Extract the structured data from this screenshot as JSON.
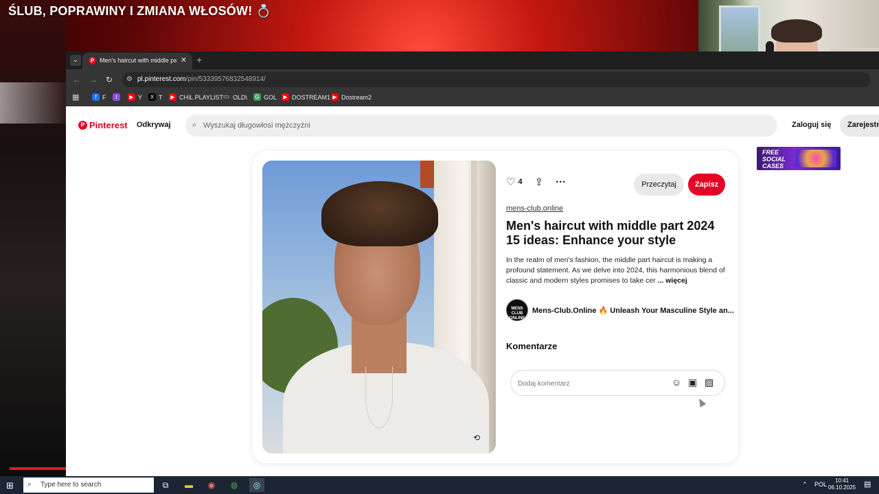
{
  "stream": {
    "title": "ŚLUB, POPRAWINY I ZMIANA WŁOSÓW! 💍"
  },
  "browser": {
    "tab_title": "Men's haircut with middle part",
    "tab_close": "✕",
    "url_host": "pl.pinterest.com",
    "url_path": "/pin/53339576832548914/",
    "bookmarks": [
      {
        "label": "F",
        "icon": "facebook-icon",
        "color": "#1877f2"
      },
      {
        "label": "",
        "icon": "twitch-icon",
        "color": "#9146ff"
      },
      {
        "label": "Y",
        "icon": "youtube-icon",
        "color": "#ff0000"
      },
      {
        "label": "T",
        "icon": "x-icon",
        "color": "#000000"
      },
      {
        "label": "CHIL PLAYLIST",
        "icon": "youtube-icon",
        "color": "#ff0000"
      },
      {
        "label": "OLD\\",
        "icon": "folder-icon",
        "color": "#555555"
      },
      {
        "label": "GOL",
        "icon": "gol-icon",
        "color": "#3aa45a"
      },
      {
        "label": "DOSTREAM1",
        "icon": "youtube-icon",
        "color": "#ff0000"
      },
      {
        "label": "Dostream2",
        "icon": "youtube-icon",
        "color": "#ff0000"
      }
    ]
  },
  "pinterest": {
    "logo": "Pinterest",
    "explore": "Odkrywaj",
    "search_placeholder": "Wyszukaj długowłosi mężczyźni",
    "login": "Zaloguj się",
    "register": "Zarejestruj się",
    "ad": {
      "line1": "FREE",
      "line2": "SOCIAL",
      "line3": "CASES"
    },
    "pin": {
      "likes": "4",
      "read_button": "Przeczytaj",
      "save_button": "Zapisz",
      "source": "mens-club.online",
      "title": "Men's haircut with middle part 2024 15 ideas: Enhance your style",
      "description": "In the realm of men's fashion, the middle part haircut is making a profound statement. As we delve into 2024, this harmonious blend of classic and modern styles promises to take cer",
      "more": "... więcej",
      "profile_name": "Mens-Club.Online 🔥 Unleash Your Masculine Style an...",
      "avatar_text": "MENS CLUB ONLINE",
      "comments_heading": "Komentarze",
      "comment_placeholder": "Dodaj komentarz"
    }
  },
  "taskbar": {
    "search_text": "Type here to search",
    "lang": "POL",
    "time": "10:41",
    "date": "06.10.2025"
  },
  "colors": {
    "pinterest_red": "#e60023",
    "taskbar": "#1c2533"
  }
}
